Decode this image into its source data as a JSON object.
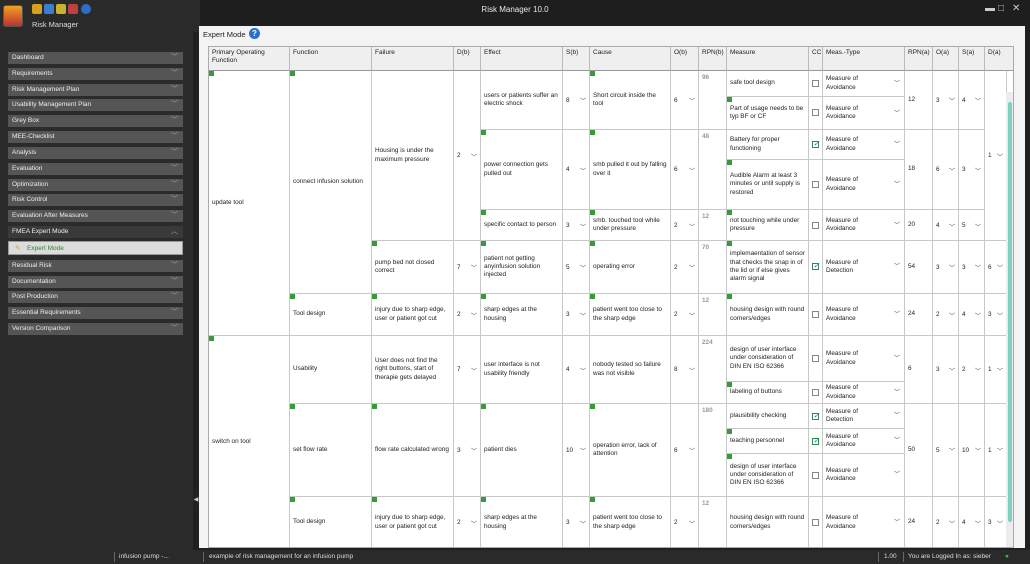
{
  "app": {
    "title": "Risk Manager   10.0",
    "module": "Risk Manager"
  },
  "window_controls": {
    "minimize": "▬",
    "maximize": "□",
    "close": "✕"
  },
  "nav": [
    {
      "label": "Dashboard"
    },
    {
      "label": "Requirements"
    },
    {
      "label": "Risk Management Plan"
    },
    {
      "label": "Usability Management Plan"
    },
    {
      "label": "Grey Box"
    },
    {
      "label": "MEE-Checklist"
    },
    {
      "label": "Analysis"
    },
    {
      "label": "Evaluation"
    },
    {
      "label": "Optimization"
    },
    {
      "label": "Risk Control"
    },
    {
      "label": "Evaluation After Measures"
    },
    {
      "label": "FMEA Expert Mode"
    },
    {
      "label": "Residual Risk"
    },
    {
      "label": "Documentation"
    },
    {
      "label": "Post Production"
    },
    {
      "label": "Essential Requirements"
    },
    {
      "label": "Version Comparison"
    }
  ],
  "subnav": {
    "label": "Expert Mode"
  },
  "main": {
    "mode_label": "Expert Mode",
    "help": "?"
  },
  "columns": [
    "Primary Operating Function",
    "Function",
    "Failure",
    "D(b)",
    "Effect",
    "S(b)",
    "Cause",
    "O(b)",
    "RPN(b)",
    "Measure",
    "CC",
    "Meas.-Type",
    "RPN(a)",
    "O(a)",
    "S(a)",
    "D(a)"
  ],
  "rows": {
    "pof1": "update tool",
    "pof2": "switch on tool",
    "fn1": "connect infusion solution",
    "fn2": "Tool design",
    "fn3": "Usability",
    "fn4": "set flow rate",
    "fn5": "Tool design",
    "fl1": "Housing is under the maximum pressure",
    "fl2": "pump bed not closed correct",
    "fl3": "injury due to sharp edge, user or patient got cut",
    "fl4": "User does not find the right buttons, start of therapie gets delayed",
    "fl5": "flow rate calculated wrong",
    "fl6": "injury due to sharp edge, user or patient got cut",
    "db1": "2",
    "db2": "7",
    "db3": "2",
    "db4": "7",
    "db5": "3",
    "db6": "2",
    "ef1": "users or patients suffer an electric shock",
    "ef2": "power connection gets pulled out",
    "ef3": "specific contact to person",
    "ef4": "patient not getting anyinfusion solution injected",
    "ef5": "sharp edges at the housing",
    "ef6": "user interface is not usability friendly",
    "ef7": "patient dies",
    "ef8": "sharp edges at the housing",
    "sb1": "8",
    "sb2": "4",
    "sb3": "3",
    "sb4": "5",
    "sb5": "3",
    "sb6": "4",
    "sb7": "10",
    "sb8": "3",
    "ca1": "Short circuit inside the tool",
    "ca2": "smb pulled it out by falling over it",
    "ca3": "smb. touched tool while under pressure",
    "ca4": "operating error",
    "ca5": "patient went too close to the sharp edge",
    "ca6": "nobody tested so failure was not visible",
    "ca7": "operation error, lack of attention",
    "ca8": "patient went too close to the sharp edge",
    "ob1": "6",
    "ob2": "6",
    "ob3": "2",
    "ob4": "2",
    "ob5": "2",
    "ob6": "8",
    "ob7": "6",
    "ob8": "2",
    "rb1": "96",
    "rb2": "48",
    "rb3": "12",
    "rb4": "70",
    "rb5": "12",
    "rb6": "224",
    "rb7": "180",
    "rb8": "12",
    "rb9": "12",
    "me1": "safe tool design",
    "me2": "Part of usage needs to be typ BF or CF",
    "me3": "Battery for proper functioning",
    "me4": "Audible Alarm at least 3 minutes or until supply is restored",
    "me5": "not touching while under pressure",
    "me6": "implemaentation of sensor that checks the snap in of the lid or if else gives alarm signal",
    "me7": "housing design with round corners/edges",
    "me8": "design of user interface under consideration of DIN EN ISO 62366",
    "me9": "labeling of buttons",
    "me10": "plausibility checking",
    "me11": "teaching personnel",
    "me12": "design of user interface under consideration of DIN EN ISO 62366",
    "me13": "housing design with round corners/edges",
    "mt1": "Measure of Avoidance",
    "mt2": "Measure of Avoidance",
    "mt3": "Measure of Avoidance",
    "mt4": "Measure of Avoidance",
    "mt5": "Measure of Avoidance",
    "mt6": "Measure of Detection",
    "mt7": "Measure of Avoidance",
    "mt8": "Measure of Avoidance",
    "mt9": "Measure of Avoidance",
    "mt10": "Measure of Detection",
    "mt11": "Measure of Avoidance",
    "mt12": "Measure of Avoidance",
    "mt13": "Measure of Avoidance",
    "ra1": "12",
    "ra2": "18",
    "ra3": "20",
    "ra4": "54",
    "ra5": "24",
    "ra6": "6",
    "ra7": "50",
    "ra8": "24",
    "oa1": "3",
    "oa2": "6",
    "oa3": "4",
    "oa4": "3",
    "oa5": "2",
    "oa6": "3",
    "oa7": "5",
    "oa8": "2",
    "sa1": "4",
    "sa2": "3",
    "sa3": "5",
    "sa4": "3",
    "sa5": "4",
    "sa6": "2",
    "sa7": "10",
    "sa8": "4",
    "da1": "1",
    "da2": "6",
    "da3": "3",
    "da4": "1",
    "da5": "1",
    "da6": "3"
  },
  "status": {
    "project": "infusion pump -...",
    "description": "example of risk management for an infusion pump",
    "version": "1.00",
    "login": "You are Logged In as: sieber"
  }
}
